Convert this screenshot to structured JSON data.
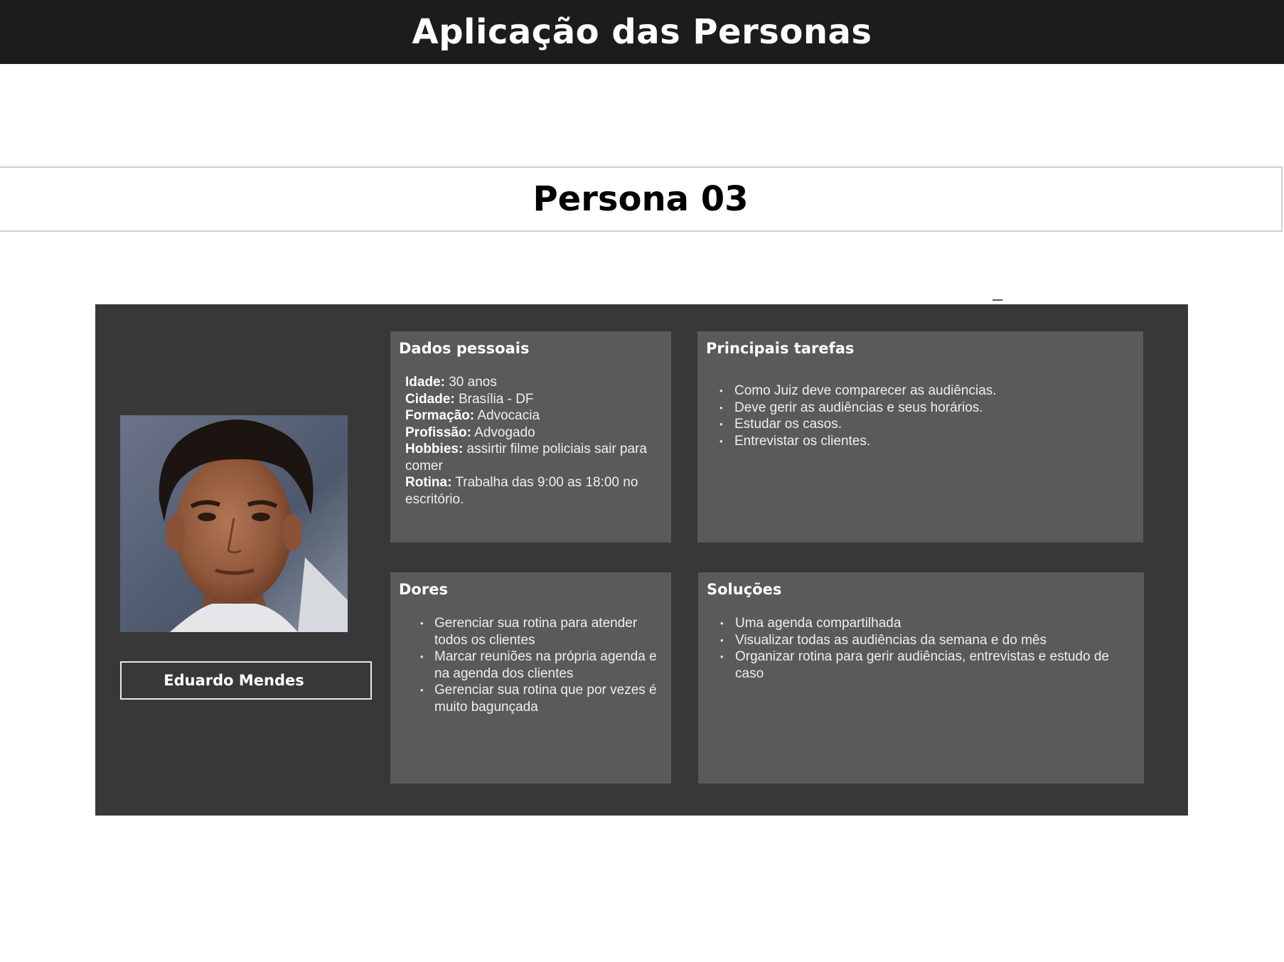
{
  "header": {
    "title": "Aplicação das Personas"
  },
  "persona": {
    "label": "Persona 03",
    "name": "Eduardo Mendes"
  },
  "dados_pessoais": {
    "title": "Dados pessoais",
    "fields": [
      {
        "label": "Idade:",
        "value": " 30 anos"
      },
      {
        "label": "Cidade:",
        "value": " Brasília - DF"
      },
      {
        "label": "Formação:",
        "value": " Advocacia"
      },
      {
        "label": "Profissão:",
        "value": " Advogado"
      },
      {
        "label": "Hobbies:",
        "value": " assirtir filme policiais sair para comer"
      },
      {
        "label": "Rotina:",
        "value": " Trabalha das 9:00 as 18:00 no escritório."
      }
    ]
  },
  "principais_tarefas": {
    "title": "Principais tarefas",
    "items": [
      "Como Juiz deve comparecer as audiências.",
      "Deve gerir as audiências e seus horários.",
      "Estudar os casos.",
      "Entrevistar os clientes."
    ]
  },
  "dores": {
    "title": "Dores",
    "items": [
      "Gerenciar sua rotina para atender todos os clientes",
      "Marcar reuniões na própria agenda e na agenda dos clientes",
      "Gerenciar sua rotina que por vezes é muito bagunçada"
    ]
  },
  "solucoes": {
    "title": "Soluções",
    "items": [
      "Uma agenda compartilhada",
      "Visualizar todas as audiências da semana e do mês",
      "Organizar rotina para gerir audiências, entrevistas e estudo de caso"
    ]
  }
}
